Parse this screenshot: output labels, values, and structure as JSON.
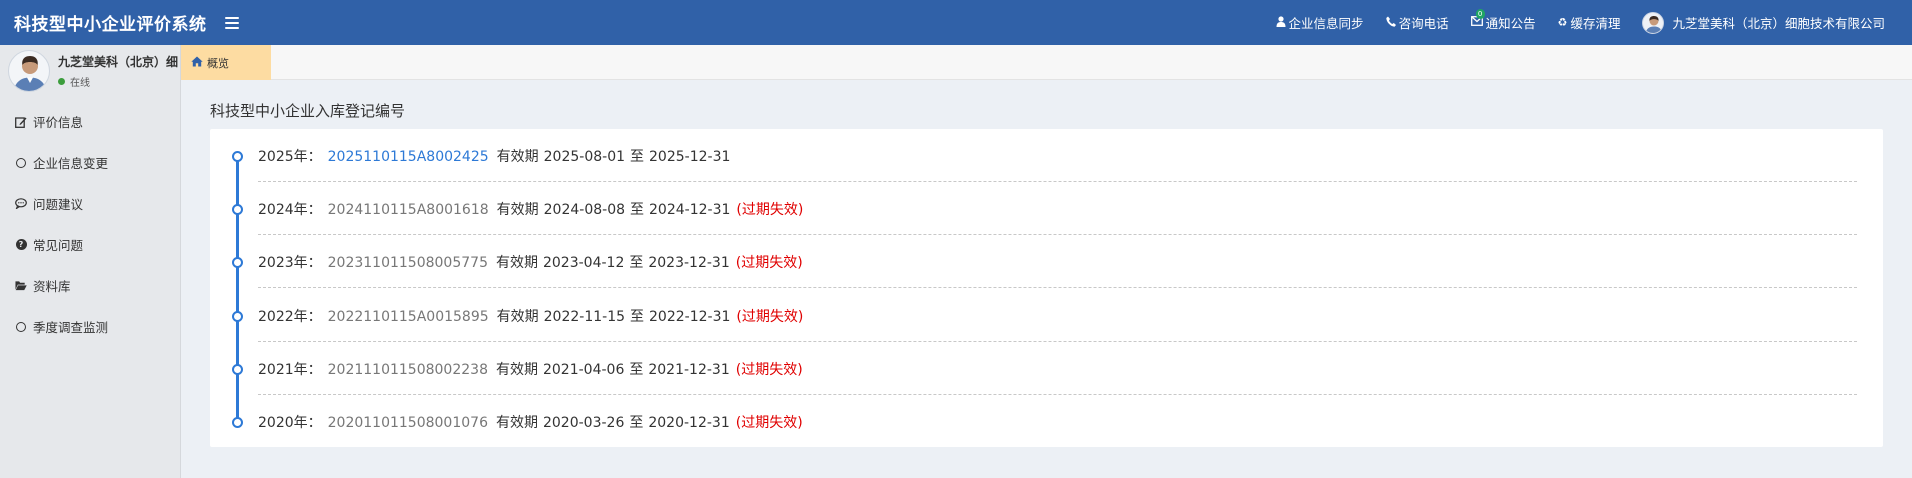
{
  "header": {
    "title": "科技型中小企业评价系统",
    "nav": [
      {
        "icon": "user-icon",
        "label": "企业信息同步"
      },
      {
        "icon": "phone-icon",
        "label": "咨询电话"
      },
      {
        "icon": "envelope-icon",
        "label": "通知公告",
        "badge": "0"
      },
      {
        "icon": "recycle-icon",
        "label": "缓存清理"
      }
    ],
    "account_name": "九芝堂美科（北京）细胞技术有限公司"
  },
  "sidebar": {
    "user_name": "九芝堂美科（北京）细",
    "status": "在线",
    "items": [
      {
        "icon": "edit-icon",
        "label": "评价信息"
      },
      {
        "icon": "circle-icon",
        "label": "企业信息变更"
      },
      {
        "icon": "comment-icon",
        "label": "问题建议"
      },
      {
        "icon": "question-circle-icon",
        "label": "常见问题"
      },
      {
        "icon": "folder-open-icon",
        "label": "资料库"
      },
      {
        "icon": "circle-icon",
        "label": "季度调查监测"
      }
    ]
  },
  "tabs": [
    {
      "icon": "home-icon",
      "label": "概览",
      "active": true
    }
  ],
  "main": {
    "section_title": "科技型中小企业入库登记编号",
    "validity_label": "有效期",
    "to_label": "至",
    "records": [
      {
        "year": "2025年：",
        "number": "2025110115A8002425",
        "start": "2025-08-01",
        "end": "2025-12-31",
        "status": ""
      },
      {
        "year": "2024年：",
        "number": "2024110115A8001618",
        "start": "2024-08-08",
        "end": "2024-12-31",
        "status": "(过期失效)"
      },
      {
        "year": "2023年：",
        "number": "202311011508005775",
        "start": "2023-04-12",
        "end": "2023-12-31",
        "status": "(过期失效)"
      },
      {
        "year": "2022年：",
        "number": "2022110115A0015895",
        "start": "2022-11-15",
        "end": "2022-12-31",
        "status": "(过期失效)"
      },
      {
        "year": "2021年：",
        "number": "202111011508002238",
        "start": "2021-04-06",
        "end": "2021-12-31",
        "status": "(过期失效)"
      },
      {
        "year": "2020年：",
        "number": "202011011508001076",
        "start": "2020-03-26",
        "end": "2020-12-31",
        "status": "(过期失效)"
      }
    ]
  },
  "colors": {
    "header_bg": "#3061a8",
    "timeline_accent": "#2d79d6",
    "expired": "#e00000",
    "active_tab": "#fddca2"
  }
}
